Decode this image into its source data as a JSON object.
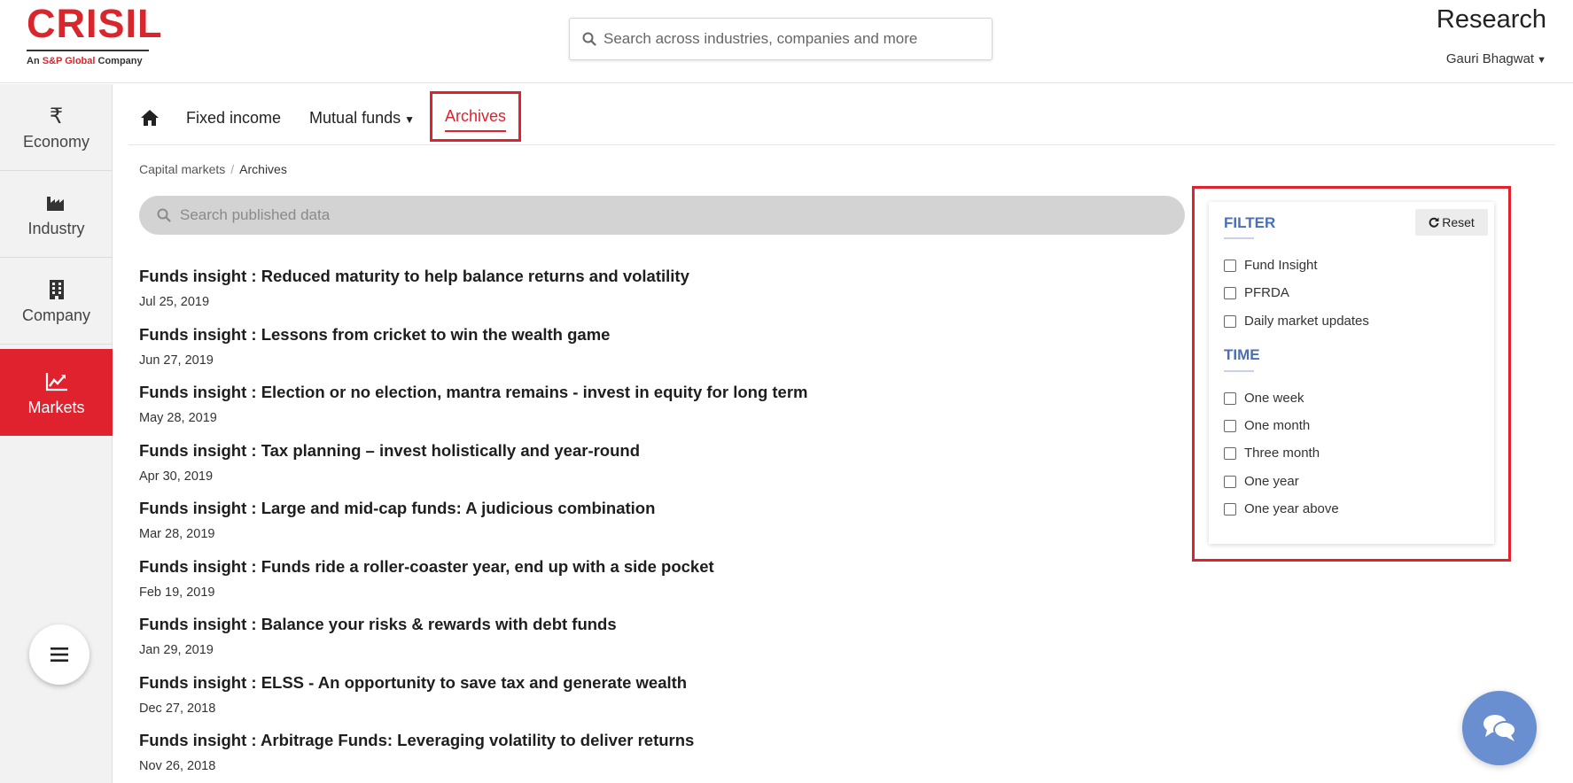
{
  "header": {
    "logo_text": "CRISIL",
    "logo_tagline_prefix": "An ",
    "logo_tagline_brand": "S&P Global",
    "logo_tagline_suffix": " Company",
    "search_placeholder": "Search across industries, companies and more",
    "title": "Research",
    "user_name": "Gauri Bhagwat"
  },
  "sidebar": {
    "items": [
      {
        "label": "Economy",
        "icon": "rupee-icon"
      },
      {
        "label": "Industry",
        "icon": "industry-icon"
      },
      {
        "label": "Company",
        "icon": "building-icon"
      },
      {
        "label": "Markets",
        "icon": "line-chart-icon",
        "active": true
      }
    ],
    "menu_icon": "hamburger-menu-icon"
  },
  "subnav": {
    "home_icon": "home-icon",
    "tabs": [
      {
        "label": "Fixed income"
      },
      {
        "label": "Mutual funds",
        "has_dropdown": true
      },
      {
        "label": "Archives",
        "active": true
      }
    ]
  },
  "breadcrumb": {
    "items": [
      "Capital markets",
      "Archives"
    ],
    "separator": "/"
  },
  "publish_search": {
    "placeholder": "Search published data"
  },
  "articles": [
    {
      "title": "Funds insight : Reduced maturity to help balance returns and volatility",
      "date": "Jul 25, 2019"
    },
    {
      "title": "Funds insight : Lessons from cricket to win the wealth game",
      "date": "Jun 27, 2019"
    },
    {
      "title": "Funds insight : Election or no election, mantra remains - invest in equity for long term",
      "date": "May 28, 2019"
    },
    {
      "title": "Funds insight : Tax planning – invest holistically and year-round",
      "date": "Apr 30, 2019"
    },
    {
      "title": "Funds insight : Large and mid-cap funds: A judicious combination",
      "date": "Mar 28, 2019"
    },
    {
      "title": "Funds insight : Funds ride a roller-coaster year, end up with a side pocket",
      "date": "Feb 19, 2019"
    },
    {
      "title": "Funds insight : Balance your risks & rewards with debt funds",
      "date": "Jan 29, 2019"
    },
    {
      "title": "Funds insight : ELSS - An opportunity to save tax and generate wealth",
      "date": "Dec 27, 2018"
    },
    {
      "title": "Funds insight : Arbitrage Funds: Leveraging volatility to deliver returns",
      "date": "Nov 26, 2018"
    }
  ],
  "filter": {
    "heading": "FILTER",
    "reset_label": "Reset",
    "type_options": [
      "Fund Insight",
      "PFRDA",
      "Daily market updates"
    ],
    "time_heading": "TIME",
    "time_options": [
      "One week",
      "One month",
      "Three month",
      "One year",
      "One year above"
    ]
  },
  "colors": {
    "brand_red": "#e0222e",
    "filter_heading_blue": "#4a6fb5",
    "chat_button": "#6a8fd0"
  },
  "chat": {
    "icon": "chat-bubbles-icon"
  }
}
